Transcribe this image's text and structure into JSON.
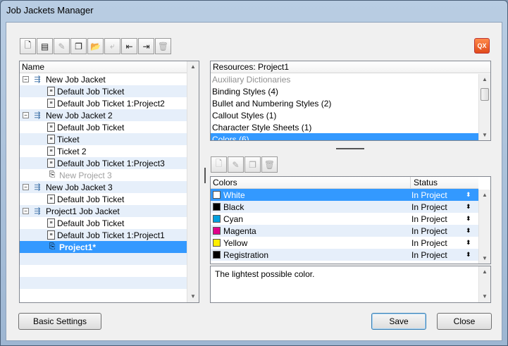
{
  "window": {
    "title": "Job Jackets Manager"
  },
  "toolbar": {
    "buttons": [
      {
        "icon": "new-jacket-icon",
        "glyph": "🗋",
        "enabled": true
      },
      {
        "icon": "new-ticket-icon",
        "glyph": "▤",
        "enabled": true
      },
      {
        "icon": "edit-icon",
        "glyph": "✎",
        "enabled": false
      },
      {
        "icon": "duplicate-icon",
        "glyph": "❐",
        "enabled": true
      },
      {
        "icon": "open-icon",
        "glyph": "📂",
        "enabled": true
      },
      {
        "icon": "link-icon",
        "glyph": "⤶",
        "enabled": false
      },
      {
        "icon": "import-icon",
        "glyph": "⇤",
        "enabled": true
      },
      {
        "icon": "export-icon",
        "glyph": "⇥",
        "enabled": true
      },
      {
        "icon": "delete-icon",
        "glyph": "🗑",
        "enabled": false
      }
    ],
    "qx_badge": "QX"
  },
  "tree": {
    "header": "Name",
    "items": [
      {
        "level": 0,
        "expander": "−",
        "kind": "jacket",
        "label": "New Job Jacket"
      },
      {
        "level": 1,
        "kind": "ticket",
        "label": "Default Job Ticket"
      },
      {
        "level": 1,
        "kind": "ticket",
        "label": "Default Job Ticket 1:Project2"
      },
      {
        "level": 0,
        "expander": "−",
        "kind": "jacket",
        "label": "New Job Jacket 2"
      },
      {
        "level": 1,
        "kind": "ticket",
        "label": "Default Job Ticket"
      },
      {
        "level": 1,
        "kind": "ticket",
        "label": "Ticket"
      },
      {
        "level": 1,
        "kind": "ticket",
        "label": "Ticket 2"
      },
      {
        "level": 1,
        "kind": "ticket",
        "label": "Default Job Ticket 1:Project3"
      },
      {
        "level": 1,
        "kind": "project",
        "label": "New Project 3",
        "dim": true
      },
      {
        "level": 0,
        "expander": "−",
        "kind": "jacket",
        "label": "New Job Jacket 3"
      },
      {
        "level": 1,
        "kind": "ticket",
        "label": "Default Job Ticket"
      },
      {
        "level": 0,
        "expander": "−",
        "kind": "jacket",
        "label": "Project1 Job Jacket"
      },
      {
        "level": 1,
        "kind": "ticket",
        "label": "Default Job Ticket"
      },
      {
        "level": 1,
        "kind": "ticket",
        "label": "Default Job Ticket 1:Project1"
      },
      {
        "level": 1,
        "kind": "project",
        "label": "Project1*",
        "selected": true,
        "bold": true
      }
    ]
  },
  "resources": {
    "header": "Resources: Project1",
    "items": [
      {
        "label": "Auxiliary Dictionaries",
        "dim": true
      },
      {
        "label": "Binding Styles (4)"
      },
      {
        "label": "Bullet and Numbering Styles (2)"
      },
      {
        "label": "Callout Styles (1)"
      },
      {
        "label": "Character Style Sheets (1)"
      },
      {
        "label": "Colors (6)",
        "selected": true
      }
    ]
  },
  "detail_toolbar": {
    "buttons": [
      {
        "icon": "new-icon",
        "glyph": "🗋",
        "enabled": false
      },
      {
        "icon": "edit-icon",
        "glyph": "✎",
        "enabled": false
      },
      {
        "icon": "duplicate-icon",
        "glyph": "❐",
        "enabled": false
      },
      {
        "icon": "delete-icon",
        "glyph": "🗑",
        "enabled": false
      }
    ]
  },
  "colors_table": {
    "col_name": "Colors",
    "col_status": "Status",
    "rows": [
      {
        "name": "White",
        "status": "In Project",
        "swatch": "#ffffff",
        "selected": true
      },
      {
        "name": "Black",
        "status": "In Project",
        "swatch": "#000000"
      },
      {
        "name": "Cyan",
        "status": "In Project",
        "swatch": "#00a0e0"
      },
      {
        "name": "Magenta",
        "status": "In Project",
        "swatch": "#e0008a"
      },
      {
        "name": "Yellow",
        "status": "In Project",
        "swatch": "#ffee00"
      },
      {
        "name": "Registration",
        "status": "In Project",
        "swatch": "#000000"
      }
    ],
    "spin_glyph": "⬍"
  },
  "description": "The lightest possible color.",
  "buttons": {
    "basic_settings": "Basic Settings",
    "save": "Save",
    "close": "Close"
  },
  "colors": {
    "selection": "#3399ff",
    "alt_row": "#e6effa"
  }
}
